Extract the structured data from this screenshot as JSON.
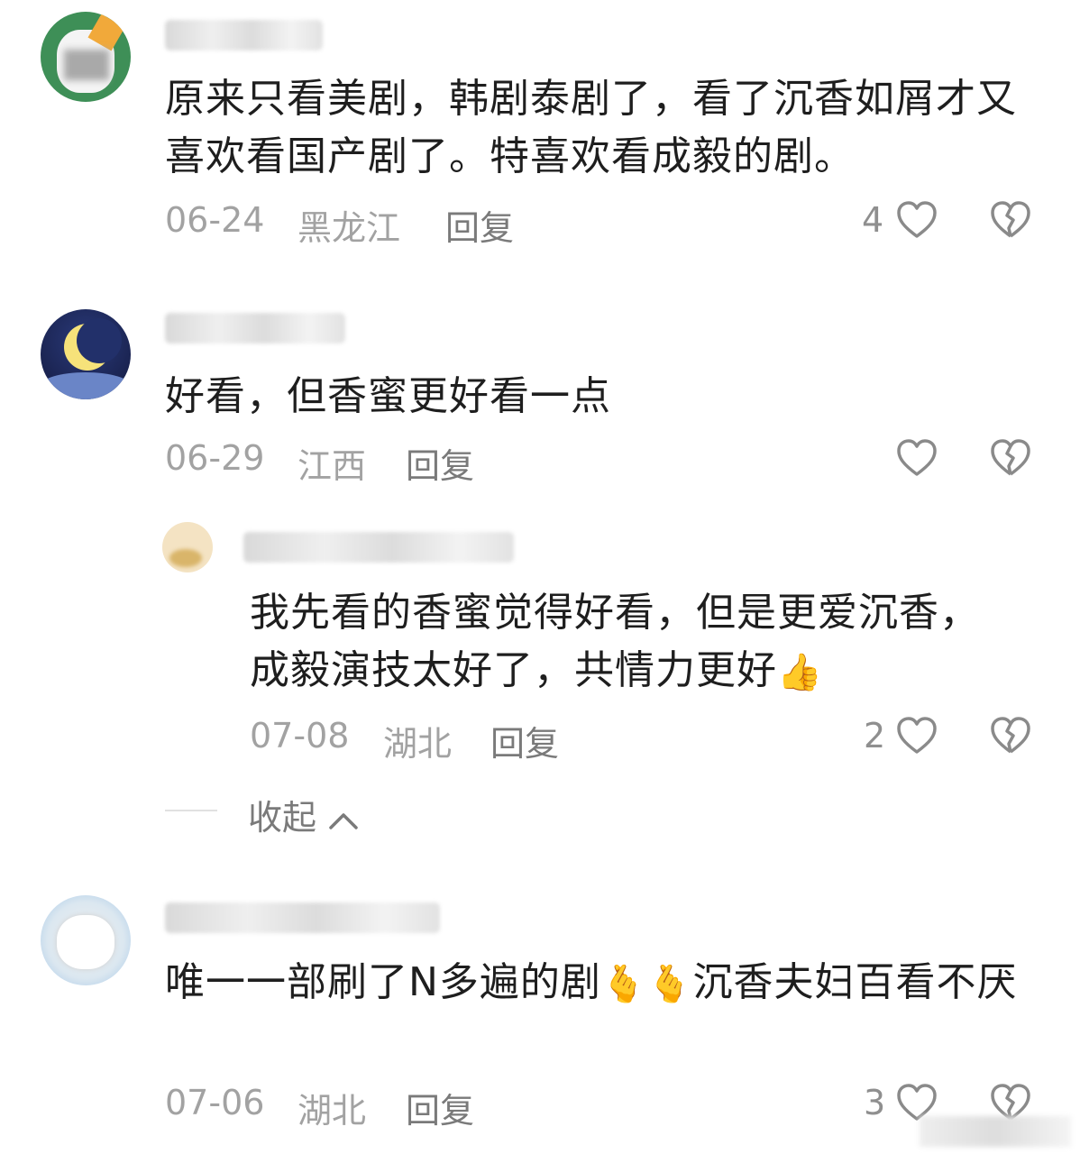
{
  "comments": [
    {
      "text": "原来只看美剧，韩剧泰剧了，看了沉香如屑才又喜欢看国产剧了。特喜欢看成毅的剧。",
      "date": "06-24",
      "region": "黑龙江",
      "reply": "回复",
      "likes": "4"
    },
    {
      "text": "好看，但香蜜更好看一点",
      "date": "06-29",
      "region": "江西",
      "reply": "回复",
      "likes": ""
    },
    {
      "text": "我先看的香蜜觉得好看，但是更爱沉香，成毅演技太好了，共情力更好",
      "emoji": "👍",
      "date": "07-08",
      "region": "湖北",
      "reply": "回复",
      "likes": "2"
    },
    {
      "text_a": "唯一一部刷了N多遍的剧",
      "emoji": "🫰",
      "text_b": "沉香夫妇百看不厌",
      "date": "07-06",
      "region": "湖北",
      "reply": "回复",
      "likes": "3"
    }
  ],
  "collapse": {
    "label": "收起"
  },
  "colors": {
    "text": "#1e1e1e",
    "meta": "#a2a2a2",
    "icon": "#8a8a8a"
  },
  "icons": [
    "heart-icon",
    "broken-heart-icon",
    "chevron-up-icon"
  ]
}
